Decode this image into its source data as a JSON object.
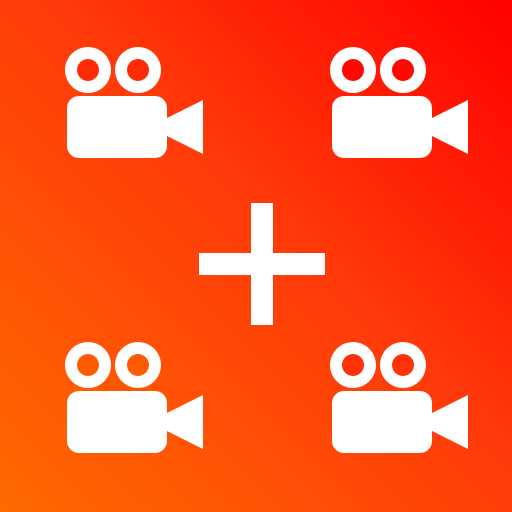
{
  "icon": {
    "name": "merge-videos-app-icon",
    "gradient_colors": [
      "#ff0000",
      "#ff3a0a",
      "#ff6a00"
    ],
    "glyph_color": "#ffffff",
    "camera_icons": [
      "video-camera-icon",
      "video-camera-icon",
      "video-camera-icon",
      "video-camera-icon"
    ],
    "center_icon": "plus-icon"
  }
}
